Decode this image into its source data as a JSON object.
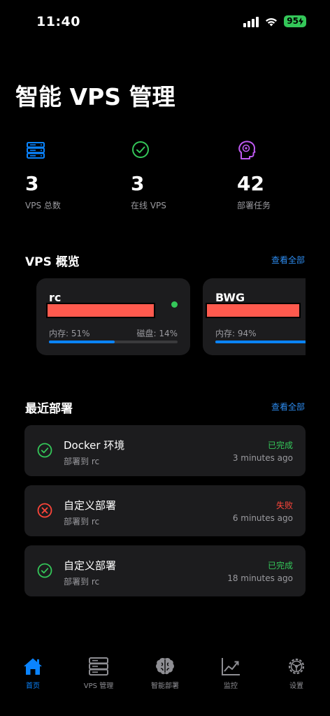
{
  "status_bar": {
    "time": "11:40",
    "battery": "95"
  },
  "header": {
    "title": "智能 VPS 管理"
  },
  "stats": [
    {
      "value": "3",
      "label": "VPS 总数",
      "icon": "server-icon",
      "color": "#0a84ff"
    },
    {
      "value": "3",
      "label": "在线 VPS",
      "icon": "check-circle-icon",
      "color": "#34c759"
    },
    {
      "value": "42",
      "label": "部署任务",
      "icon": "brain-icon",
      "color": "#bf5af2"
    }
  ],
  "vps_overview": {
    "title": "VPS 概览",
    "view_all": "查看全部",
    "cards": [
      {
        "name": "rc",
        "memory": "内存: 51%",
        "disk": "磁盘: 14%",
        "memory_fraction": 0.51,
        "online": true
      },
      {
        "name": "BWG",
        "memory": "内存: 94%",
        "memory_fraction": 0.94
      }
    ]
  },
  "recent_deploys": {
    "title": "最近部署",
    "view_all": "查看全部",
    "items": [
      {
        "title": "Docker 环境",
        "target": "部署到 rc",
        "status": "已完成",
        "time": "3 minutes ago",
        "state": "success"
      },
      {
        "title": "自定义部署",
        "target": "部署到 rc",
        "status": "失败",
        "time": "6 minutes ago",
        "state": "failed"
      },
      {
        "title": "自定义部署",
        "target": "部署到 rc",
        "status": "已完成",
        "time": "18 minutes ago",
        "state": "success"
      }
    ]
  },
  "colors": {
    "success": "#34c759",
    "failed": "#ff453a",
    "accent": "#0a84ff"
  },
  "tabs": [
    {
      "label": "首页",
      "icon": "home-icon",
      "active": true
    },
    {
      "label": "VPS 管理",
      "icon": "server-icon"
    },
    {
      "label": "智能部署",
      "icon": "brain-icon"
    },
    {
      "label": "监控",
      "icon": "chart-icon"
    },
    {
      "label": "设置",
      "icon": "gear-icon"
    }
  ]
}
